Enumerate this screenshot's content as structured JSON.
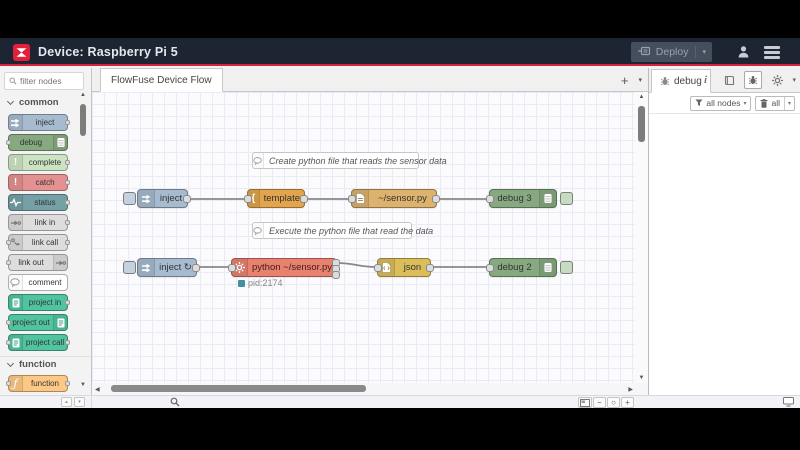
{
  "header": {
    "title": "Device: Raspberry Pi 5",
    "deploy_label": "Deploy"
  },
  "palette": {
    "filter_placeholder": "filter nodes",
    "categories": {
      "common": "common",
      "function": "function"
    },
    "items": [
      "inject",
      "debug",
      "complete",
      "catch",
      "status",
      "link in",
      "link call",
      "link out",
      "comment",
      "project in",
      "project out",
      "project call",
      "function"
    ]
  },
  "tabbar": {
    "active_tab": "FlowFuse Device Flow",
    "add_button": "+"
  },
  "flow": {
    "comments": [
      "Create python file that reads the sensor data",
      "Execute the python file that read the data"
    ],
    "nodes": {
      "inject1": "inject",
      "template": "template",
      "file": "~/sensor.py",
      "debug3": "debug 3",
      "inject2": "inject ↻",
      "exec": "python ~/sensor.py",
      "json": "json",
      "debug2": "debug 2"
    },
    "exec_status": "pid:2174"
  },
  "sidebar": {
    "tab_label": "debug",
    "filter_nodes_label": "all nodes",
    "clear_label": "all"
  },
  "glyphs": {
    "caret_down": "▾",
    "scroll_up": "▲",
    "scroll_down": "▼",
    "scroll_left": "◀",
    "scroll_right": "▶",
    "zoom_out": "−",
    "zoom_reset": "○",
    "zoom_in": "+",
    "collapse_all": "▴",
    "expand_all": "▾",
    "complete_icon": "!",
    "catch_icon": "!",
    "function_icon": "ƒ",
    "template_icon": "{",
    "info_icon": "i"
  },
  "colors": {
    "accent_red": "#d6223e",
    "header_bg": "#1d2533",
    "node_inject": "#a6bbcf",
    "node_debug": "#87a980",
    "node_complete": "#cde4c3",
    "node_catch": "#e49191",
    "node_status": "#75a0a5",
    "node_link": "#dddddd",
    "node_comment": "#ffffff",
    "node_project": "#50c3a0",
    "node_function": "#fdc886",
    "node_template": "#e2a54b",
    "node_file": "#dcb26e",
    "node_exec": "#e8826f",
    "node_json": "#dbbd5a",
    "wire": "#888888",
    "status_dot": "#4590a0"
  }
}
